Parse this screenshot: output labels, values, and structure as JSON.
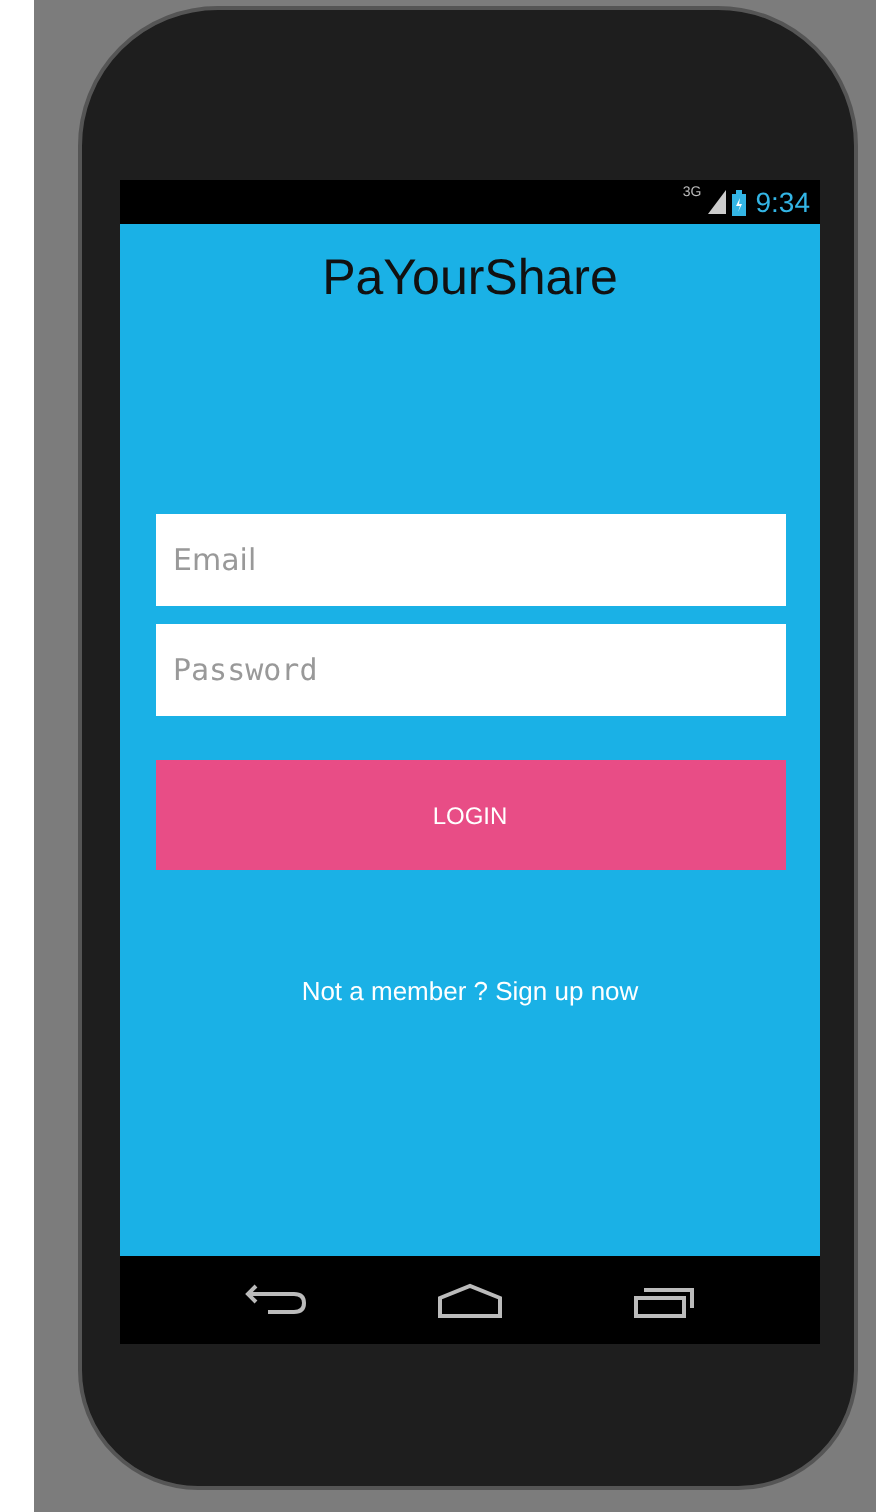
{
  "status_bar": {
    "network": "3G",
    "time": "9:34"
  },
  "title": "PaYourShare",
  "fields": [
    {
      "kind": "email",
      "placeholder": "Email"
    },
    {
      "kind": "password",
      "placeholder": "Password"
    }
  ],
  "login_button": "LOGIN",
  "signup_link": "Not a member ? Sign up now"
}
